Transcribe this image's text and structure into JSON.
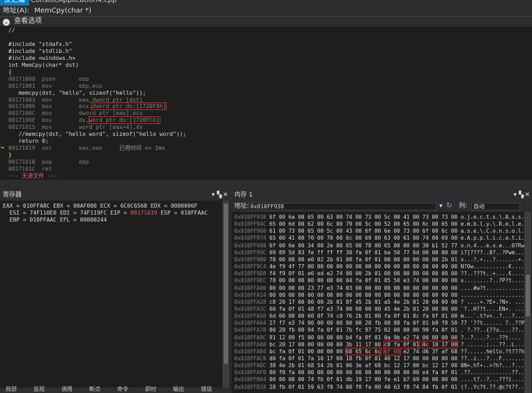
{
  "top": {
    "tab_label": "反汇编",
    "file_label": "ConsoleApplication4.cpp",
    "address_label": "地址(A):",
    "address_value": "MemCpy(char *)",
    "options_label": "查看选项"
  },
  "code": {
    "lines": [
      {
        "t": "//",
        "cls": "c-comm"
      },
      {
        "t": "",
        "cls": "c-src"
      },
      {
        "t": "#include \"stdafx.h\"",
        "cls": "c-src"
      },
      {
        "t": "#include \"stdlib.h\"",
        "cls": "c-src"
      },
      {
        "t": "#include <windows.h>",
        "cls": "c-src"
      },
      {
        "t": "int MemCpy(char* dst)",
        "cls": "c-src"
      },
      {
        "t": "{",
        "cls": "c-src"
      },
      {
        "addr": "00171000",
        "op": "push",
        "arg": "ebp"
      },
      {
        "addr": "00171001",
        "op": "mov",
        "arg": "ebp,esp"
      },
      {
        "t": "   memcpy(dst, \"hello\", sizeof(\"hello\"));",
        "cls": "c-src"
      },
      {
        "addr": "00171003",
        "op": "mov",
        "arg": "eax,dword ptr [dst]"
      },
      {
        "addr": "00171006",
        "op": "mov",
        "arg": "ecx,",
        "box": "dword ptr ds:[1720F8h]"
      },
      {
        "addr": "0017100C",
        "op": "mov",
        "arg": "dword ptr [eax],ecx"
      },
      {
        "addr": "0017100E",
        "op": "mov",
        "arg": "dx,",
        "box": "word ptr ds:[1720FCh]"
      },
      {
        "addr": "00171015",
        "op": "mov",
        "arg": "word ptr [eax+4],dx"
      },
      {
        "t": "   //memcpy(dst, \"hello word\", sizeof(\"hello word\"));",
        "cls": "c-src"
      },
      {
        "t": "   return 0;",
        "cls": "c-src"
      },
      {
        "addr": "00171019",
        "op": "xor",
        "arg": "eax,eax",
        "note": "已用时间 <= 1ms",
        "cur": true
      },
      {
        "t": "}",
        "cls": "c-src"
      },
      {
        "addr": "0017101B",
        "op": "pop",
        "arg": "ebp"
      },
      {
        "addr": "0017101C",
        "op": "ret",
        "arg": ""
      },
      {
        "t": "--- 无源文件 ---",
        "cls": "redtxt"
      }
    ]
  },
  "registers": {
    "title": "寄存器",
    "lines": [
      {
        "t": "EAX = 010FFA8C EBX = 00AF000 ECX = 6C6C6568 EDX = 0000006F"
      },
      {
        "t": "  ESI = 74F110E0 EDI = 74F119FC EIP = ",
        "red": "00171019",
        "after": " ESP = 010FFAAC"
      },
      {
        "t": "  EBP = 010FFAAC EFL = 00000244"
      }
    ]
  },
  "memory": {
    "title": "内存 1",
    "address_label": "地址:",
    "address_value": "0x010FF938",
    "columns_label": "列:",
    "columns_value": "自动",
    "rows": [
      {
        "a": "0x010FF938",
        "h": "6f 00 6a 00 65 00 63 00 74 00 73 00 5c 00 41 00 73 00 73 00",
        "s": "o.j.e.c.t.s.\\.A.s.s."
      },
      {
        "a": "0x010FF94C",
        "h": "65 00 6d 00 62 00 6c 00 79 00 5c 00 52 00 65 00 6c 00 65 00",
        "s": "e.m.b.l.y.\\.R.e.l.e."
      },
      {
        "a": "0x010FF960",
        "h": "61 00 73 00 65 00 5c 00 43 00 6f 00 6e 00 73 00 6f 00 6c 00",
        "s": "a.s.e.\\.C.o.n.s.o.l."
      },
      {
        "a": "0x010FF974",
        "h": "65 00 41 00 70 00 70 00 6c 00 69 00 63 00 61 00 74 00 69 00",
        "s": "e.A.p.p.l.i.c.a.t.i."
      },
      {
        "a": "0x010FF988",
        "h": "6f 00 6e 00 34 00 2e 00 65 00 78 00 65 00 00 00 30 b1 52 77",
        "s": "o.n.4...e.x.e...0?Rw"
      },
      {
        "a": "0x010FF99C",
        "h": "69 89 5d 83 fe ff ff ff 38 fa 0f 01 ba 50 77 6d 00 00 00 00",
        "s": "i?]????..8?..?Pwm...."
      },
      {
        "a": "0x010FF9B0",
        "h": "78 00 00 00 e0 02 2b 01 08 fa 0f 01 00 00 00 00 00 00 2b 01",
        "s": "x...?.+...?.......+."
      },
      {
        "a": "0x010FF9C4",
        "h": "4e f9 4f 77 00 00 00 00 00 00 00 00 00 00 00 80 00 00 00 00",
        "s": "N?Ow...........€...."
      },
      {
        "a": "0x010FF9D8",
        "h": "f4 f9 0f 01 e6 ed e2 74 00 00 2b 01 00 00 00 80 00 00 00 00",
        "s": "??..???t..+....€...."
      },
      {
        "a": "0x010FF9EC",
        "h": "78 00 00 00 00 00 00 00 04 fa 0f 01 85 50 e3 74 00 00 00 00",
        "s": "x........?..?P?t...."
      },
      {
        "a": "0x010FFA00",
        "h": "00 00 00 00 23 77 e3 74 03 00 00 00 00 00 00 00 00 00 00 00",
        "s": "....#w?t............"
      },
      {
        "a": "0x010FFA14",
        "h": "00 00 00 00 00 00 00 00 00 00 00 00 00 00 00 00 00 00 00 00",
        "s": "...................."
      },
      {
        "a": "0x010FFA28",
        "h": "c8 20 17 00 00 00 2b 01 8f 45 2b 01 a5 4e 2b 01 20 00 00 00",
        "s": "? ....+.?E+.?N+. ..."
      },
      {
        "a": "0x010FFA3C",
        "h": "60 fa 0f 01 48 f7 e3 74 00 00 00 00 45 4e 2b 01 20 00 00 00",
        "s": "`?..H??t....EN+. ..."
      },
      {
        "a": "0x010FFA50",
        "h": "6d 00 00 00 60 0f 74 c0 76 2b 01 00 fa 0f 01 8c fa 0f 01 00",
        "s": "m...`.t?v+..?...?..."
      },
      {
        "a": "0x010FFA64",
        "h": "27 f7 e3 74 00 00 00 00 00 00 20 fb 00 88 fa 0f 01 b9 f8 50 77",
        "s": "'??t...... ?..??Pw"
      },
      {
        "a": "0x010FFA78",
        "h": "00 20 fb 00 94 fa 0f 01 7b fc 97 75 02 00 00 00 90 fa 0f 01",
        "s": ". ?.??..{??u....??.."
      },
      {
        "a": "0x010FFA8C",
        "h": "91 12 09 f5 00 00 00 00 b4 fa 0f 01 0a 9b e2 74 00 00 00 00",
        "s": "?..?....?...??t...."
      },
      {
        "a": "0x010FFAA0",
        "h": "bc 20 17 00 00 00 00 00 3b 11 17 00 ",
        "hl1": "c8 fa 0f 01",
        "h2": " ",
        "hl2": "4c 10 17 00",
        "s": "? ......;...??..L..."
      },
      {
        "a": "0x010FFAB4",
        "h": "bc fa 0f 01 00 00 00 00 ",
        "hl3": "68 65 6c 6c",
        "h3": " ",
        "red": "6f 00",
        "h4": " e2 74 d6 3f af 68",
        "s": "??......hello.?t???h"
      },
      {
        "a": "0x010FFAC8",
        "h": "d0 fa 0f 01 7a 10 17 00 18 fb 0f 01 46 12 17 00 00 00 00 00",
        "s": "??..z...?...F......."
      },
      {
        "a": "0x010FFADC",
        "h": "38 4e 2b 01 68 54 2b 01 06 3e af 68 bc 12 17 00 bc 12 17 00",
        "s": "8N+.hT+..>?h?...?..."
      },
      {
        "a": "0x010FFAF0",
        "h": "00 f0 fa 00 00 00 00 00 00 00 00 00 00 00 00 00 e4 fa 0f 01",
        "s": ".??.............??.."
      },
      {
        "a": "0x010FFB04",
        "h": "00 00 00 00 74 fb 0f 01 db 19 17 00 fe e1 b7 69 00 00 00 00",
        "s": "....t?..?...???i...."
      },
      {
        "a": "0x010FFB18",
        "h": "28 fb 0f 01 59 63 f8 74 00 f0 fa 00 40 63 f8 74 84 fb 0f 01",
        "s": "(?..Yc?t.??.@c?t??.."
      }
    ]
  },
  "bottom_tabs": [
    "局部",
    "监视",
    "调用",
    "断点",
    "命令",
    "即时",
    "输出",
    "错误"
  ]
}
